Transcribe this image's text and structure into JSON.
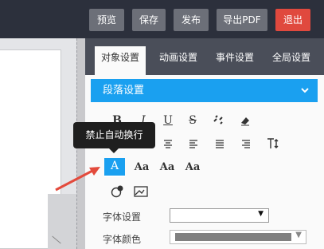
{
  "toolbar": {
    "buttons": [
      {
        "label": "预览"
      },
      {
        "label": "保存"
      },
      {
        "label": "发布"
      },
      {
        "label": "导出PDF"
      },
      {
        "label": "退出"
      }
    ],
    "colors": {
      "default": "#6c6f78",
      "exit": "#e0493e"
    }
  },
  "panel": {
    "tabs": [
      {
        "label": "对象设置",
        "active": true
      },
      {
        "label": "动画设置"
      },
      {
        "label": "事件设置"
      },
      {
        "label": "全局设置"
      }
    ],
    "section": {
      "title": "段落设置",
      "expanded": true,
      "color": "#1aa0f0"
    },
    "tools": {
      "row1": [
        {
          "glyph": "B",
          "icon": "bold-icon"
        },
        {
          "glyph": "I",
          "icon": "italic-icon"
        },
        {
          "glyph": "U",
          "icon": "underline-icon"
        },
        {
          "glyph": "S",
          "icon": "strikethrough-icon"
        },
        {
          "icon": "unlink-icon"
        },
        {
          "icon": "eraser-icon"
        }
      ],
      "row2": [
        {
          "icon": "align-center-icon"
        },
        {
          "icon": "align-left-icon"
        },
        {
          "icon": "align-justify-icon"
        },
        {
          "icon": "align-right-icon"
        },
        {
          "icon": "line-height-icon"
        }
      ],
      "row3": [
        {
          "glyph": "A",
          "icon": "no-wrap-icon",
          "active": true
        },
        {
          "glyph": "Aa",
          "icon": "font-size-icon"
        },
        {
          "glyph": "Aa",
          "icon": "superscript-icon"
        },
        {
          "glyph": "Aa",
          "icon": "subscript-icon"
        }
      ],
      "row4": [
        {
          "icon": "link-icon"
        },
        {
          "icon": "insert-image-icon"
        }
      ]
    },
    "tooltip": "禁止自动换行",
    "font_setting": {
      "label": "字体设置",
      "value": ""
    },
    "font_color": {
      "label": "字体颜色",
      "value": "#808080"
    }
  }
}
